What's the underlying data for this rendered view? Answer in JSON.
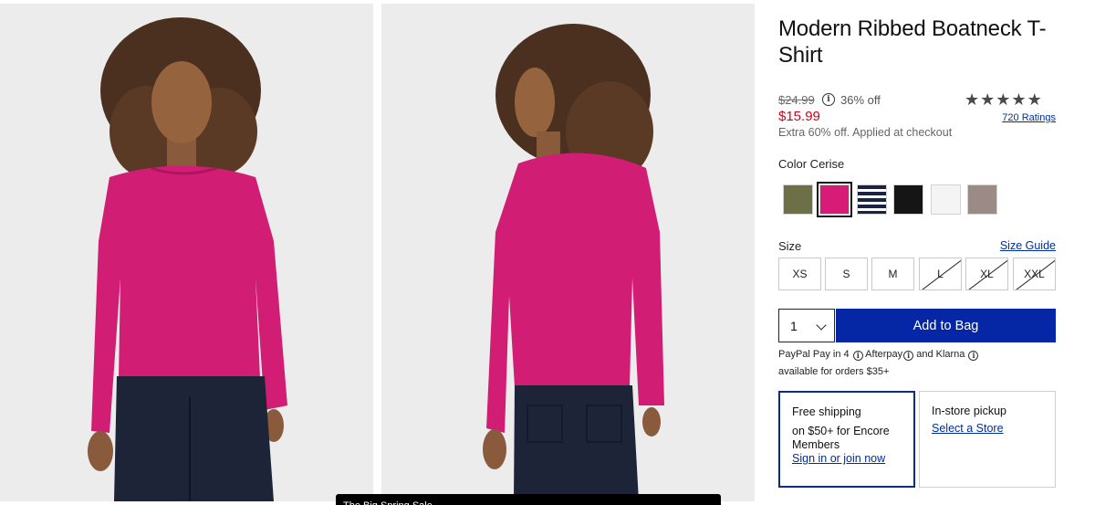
{
  "product": {
    "title": "Modern Ribbed Boatneck T-Shirt",
    "original_price": "$24.99",
    "discount": "36% off",
    "sale_price": "$15.99",
    "extra_offer": "Extra 60% off. Applied at checkout",
    "rating_stars": 5,
    "ratings_link": "720 Ratings"
  },
  "color": {
    "label": "Color Cerise",
    "swatches": [
      {
        "name": "olive",
        "hex": "#6d6f46"
      },
      {
        "name": "cerise",
        "hex": "#d81b76",
        "selected": true
      },
      {
        "name": "navy-stripe",
        "hex": "#1b2242"
      },
      {
        "name": "black",
        "hex": "#151515"
      },
      {
        "name": "white",
        "hex": "#f4f4f4"
      },
      {
        "name": "taupe",
        "hex": "#9c8a86"
      }
    ]
  },
  "size": {
    "label": "Size",
    "guide_link": "Size Guide",
    "options": [
      {
        "label": "XS",
        "available": true
      },
      {
        "label": "S",
        "available": true
      },
      {
        "label": "M",
        "available": true
      },
      {
        "label": "L",
        "available": false
      },
      {
        "label": "XL",
        "available": false
      },
      {
        "label": "XXL",
        "available": false
      }
    ]
  },
  "cart": {
    "quantity": "1",
    "add_to_bag": "Add to Bag"
  },
  "payments": {
    "paypal": "PayPal Pay in 4",
    "afterpay": "Afterpay",
    "and": "and",
    "klarna": "Klarna",
    "note": "available for orders $35+"
  },
  "fulfillment": {
    "shipping_title": "Free shipping",
    "shipping_desc": "on $50+ for Encore Members",
    "shipping_link": "Sign in or join now",
    "pickup_title": "In-store pickup",
    "pickup_link": "Select a Store"
  },
  "toast": {
    "text": "The Big Spring Sale"
  },
  "colors": {
    "accent": "#0527a6",
    "sale": "#d0021b",
    "link": "#002e99",
    "shirt": "#d11d73"
  }
}
